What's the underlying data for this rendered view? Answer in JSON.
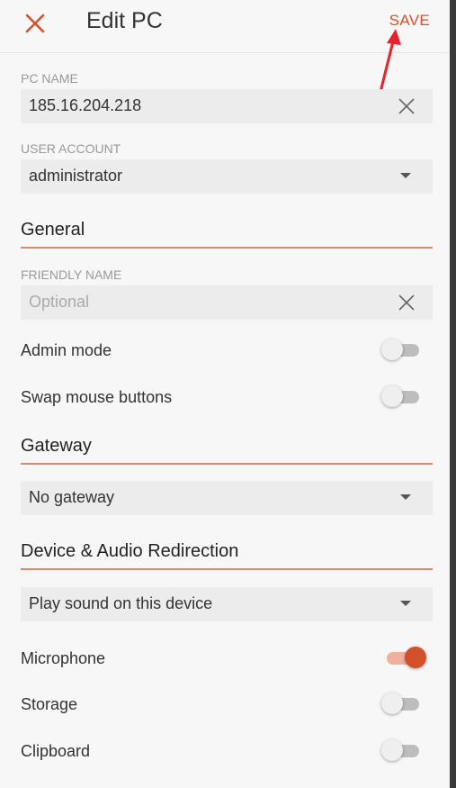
{
  "header": {
    "title": "Edit PC",
    "save_label": "SAVE"
  },
  "pc_name": {
    "label": "PC NAME",
    "value": "185.16.204.218"
  },
  "user_account": {
    "label": "USER ACCOUNT",
    "value": "administrator"
  },
  "general": {
    "title": "General",
    "friendly_name": {
      "label": "FRIENDLY NAME",
      "placeholder": "Optional",
      "value": ""
    },
    "admin_mode": {
      "label": "Admin mode",
      "on": false
    },
    "swap_mouse": {
      "label": "Swap mouse buttons",
      "on": false
    }
  },
  "gateway": {
    "title": "Gateway",
    "value": "No gateway"
  },
  "redirection": {
    "title": "Device & Audio Redirection",
    "sound": "Play sound on this device",
    "microphone": {
      "label": "Microphone",
      "on": true
    },
    "storage": {
      "label": "Storage",
      "on": false
    },
    "clipboard": {
      "label": "Clipboard",
      "on": false
    }
  },
  "colors": {
    "accent": "#d4502b",
    "annotation_arrow": "#e8222a"
  }
}
